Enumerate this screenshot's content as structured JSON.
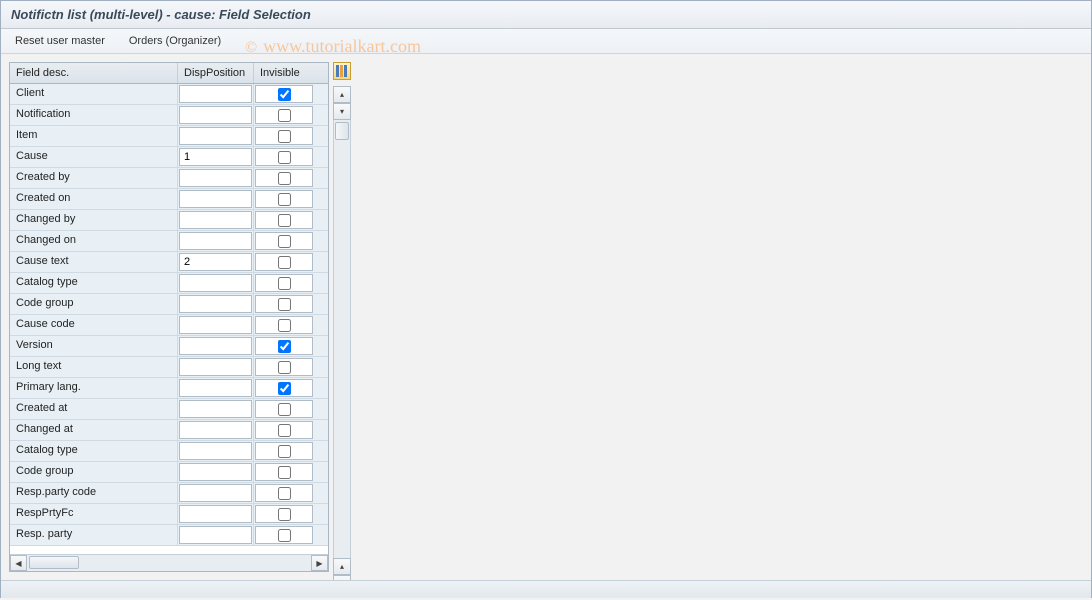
{
  "title": "Notifictn list (multi-level) - cause: Field Selection",
  "toolbar": {
    "reset_user_master": "Reset user master",
    "orders_organizer": "Orders (Organizer)"
  },
  "watermark": "www.tutorialkart.com",
  "table": {
    "headers": {
      "field_desc": "Field desc.",
      "disp_position": "DispPosition",
      "invisible": "Invisible"
    },
    "rows": [
      {
        "desc": "Client",
        "pos": "",
        "invisible": true
      },
      {
        "desc": "Notification",
        "pos": "",
        "invisible": false
      },
      {
        "desc": "Item",
        "pos": "",
        "invisible": false
      },
      {
        "desc": "Cause",
        "pos": "1",
        "invisible": false
      },
      {
        "desc": "Created by",
        "pos": "",
        "invisible": false
      },
      {
        "desc": "Created on",
        "pos": "",
        "invisible": false
      },
      {
        "desc": "Changed by",
        "pos": "",
        "invisible": false
      },
      {
        "desc": "Changed on",
        "pos": "",
        "invisible": false
      },
      {
        "desc": "Cause text",
        "pos": "2",
        "invisible": false
      },
      {
        "desc": "Catalog type",
        "pos": "",
        "invisible": false
      },
      {
        "desc": "Code group",
        "pos": "",
        "invisible": false
      },
      {
        "desc": "Cause code",
        "pos": "",
        "invisible": false
      },
      {
        "desc": "Version",
        "pos": "",
        "invisible": true
      },
      {
        "desc": "Long text",
        "pos": "",
        "invisible": false
      },
      {
        "desc": "Primary lang.",
        "pos": "",
        "invisible": true
      },
      {
        "desc": "Created at",
        "pos": "",
        "invisible": false
      },
      {
        "desc": "Changed at",
        "pos": "",
        "invisible": false
      },
      {
        "desc": "Catalog type",
        "pos": "",
        "invisible": false
      },
      {
        "desc": "Code group",
        "pos": "",
        "invisible": false
      },
      {
        "desc": "Resp.party code",
        "pos": "",
        "invisible": false
      },
      {
        "desc": "RespPrtyFc",
        "pos": "",
        "invisible": false
      },
      {
        "desc": "Resp. party",
        "pos": "",
        "invisible": false
      }
    ]
  }
}
